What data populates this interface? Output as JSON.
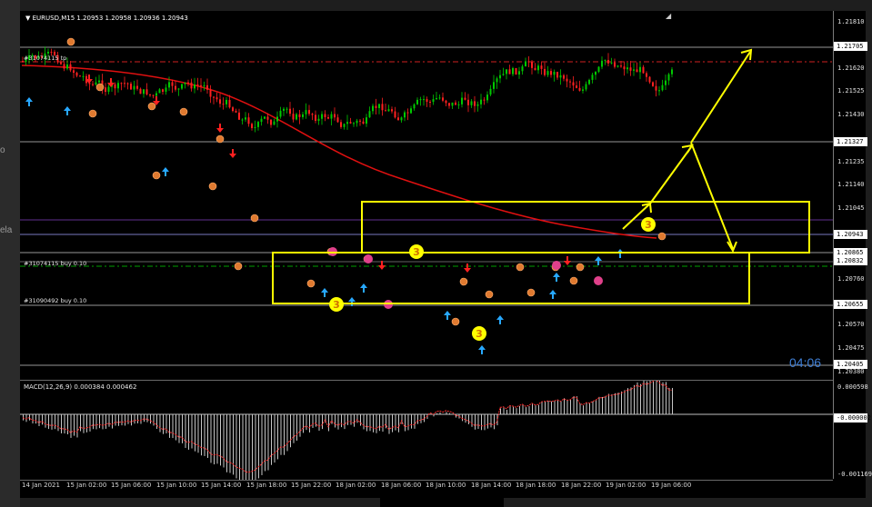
{
  "window": {
    "symbol_header": "EURUSD,M15  1.20953 1.20958 1.20936 1.20943",
    "clock": "04:06"
  },
  "side": {
    "fragment_top": "o",
    "fragment_mid": "ela"
  },
  "order_lines": [
    {
      "label": "#31074115 tp",
      "price": "1.21705"
    },
    {
      "label": "#31074115 buy 0.10",
      "price": "1.20832"
    },
    {
      "label": "#31090492 buy 0.10",
      "price": "1.20655"
    }
  ],
  "price_scale": {
    "labels": [
      "1.21810",
      "1.21620",
      "1.21525",
      "1.21430",
      "1.21235",
      "1.21140",
      "1.21045",
      "1.20760",
      "1.20570",
      "1.20475",
      "1.20380"
    ],
    "boxes": [
      "1.21705",
      "1.21327",
      "1.20943",
      "1.20865",
      "1.20832",
      "1.20655",
      "1.20405"
    ]
  },
  "macd": {
    "label": "MACD(12,26,9) 0.000384 0.000462",
    "scale_top": "0.000598",
    "scale_zero": "-0.000002",
    "scale_bottom": "-0.001169"
  },
  "time_axis": [
    "14 Jan 2021",
    "15 Jan 02:00",
    "15 Jan 06:00",
    "15 Jan 10:00",
    "15 Jan 14:00",
    "15 Jan 18:00",
    "15 Jan 22:00",
    "18 Jan 02:00",
    "18 Jan 06:00",
    "18 Jan 10:00",
    "18 Jan 14:00",
    "18 Jan 18:00",
    "18 Jan 22:00",
    "19 Jan 02:00",
    "19 Jan 06:00"
  ],
  "wave_markers": [
    "3",
    "3",
    "3",
    "3"
  ],
  "colors": {
    "background": "#000000",
    "bull_candle": "#00c800",
    "bear_candle": "#ff2020",
    "moving_average": "#e01010",
    "annotation": "#ffff00",
    "tp_line": "#d02020",
    "buy_line": "#00a000",
    "clock": "#3f7fd6"
  }
}
